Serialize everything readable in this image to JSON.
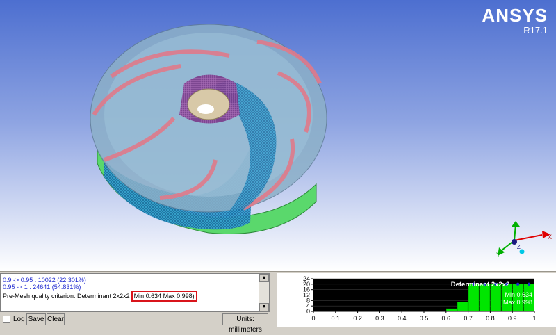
{
  "brand": {
    "name": "ANSYS",
    "version": "R17.1"
  },
  "axis_triad": {
    "labels": {
      "x": "X",
      "y": "Y",
      "z": "Z"
    }
  },
  "messages": {
    "lines": [
      "0.9 -> 0.95 : 10022 (22.301%)",
      "0.95 -> 1 : 24641 (54.831%)"
    ],
    "criterion_prefix": "Pre-Mesh quality criterion: Determinant 2x2x2",
    "criterion_minmax": "Min 0.634 Max 0.998)"
  },
  "controls": {
    "log_label": "Log",
    "log_checked": false,
    "save_label": "Save",
    "clear_label": "Clear",
    "units_label": "Units: millimeters"
  },
  "colors": {
    "blade": "#e07a8a",
    "shroud": "#8cb0c8",
    "hub_mesh": "#2a9ec8",
    "green": "#58e06a",
    "hist_bar": "#00e600",
    "hist_bg": "#000000",
    "highlight": "#d9141b"
  },
  "chart_data": {
    "type": "bar",
    "title": "Determinant 2x2x2",
    "annotations": [
      "Min 0.634",
      "Max 0.998"
    ],
    "x_ticks": [
      "0",
      "0.1",
      "0.2",
      "0.3",
      "0.4",
      "0.5",
      "0.6",
      "0.7",
      "0.8",
      "0.9",
      "1"
    ],
    "y_ticks": [
      "0",
      "4",
      "8",
      "12",
      "16",
      "20",
      "24"
    ],
    "xlim": [
      0,
      1
    ],
    "ylim": [
      0,
      24
    ],
    "bins": [
      {
        "x0": 0.6,
        "x1": 0.65,
        "value": 2
      },
      {
        "x0": 0.65,
        "x1": 0.7,
        "value": 7
      },
      {
        "x0": 0.7,
        "x1": 0.75,
        "value": 20
      },
      {
        "x0": 0.75,
        "x1": 0.8,
        "value": 20
      },
      {
        "x0": 0.8,
        "x1": 0.85,
        "value": 20
      },
      {
        "x0": 0.85,
        "x1": 0.9,
        "value": 20
      },
      {
        "x0": 0.9,
        "x1": 0.95,
        "value": 20
      },
      {
        "x0": 0.95,
        "x1": 1.0,
        "value": 20
      }
    ]
  }
}
